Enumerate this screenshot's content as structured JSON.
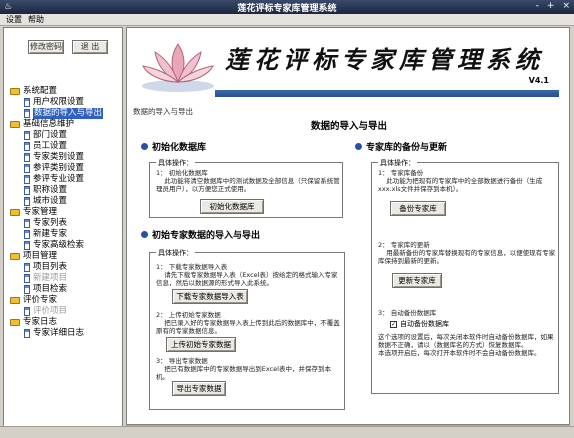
{
  "window": {
    "title": "莲花评标专家库管理系统",
    "controls": [
      "-",
      "+",
      "×"
    ]
  },
  "menu": [
    "设置",
    "帮助"
  ],
  "left": {
    "buttons": [
      "修改密码",
      "退 出"
    ],
    "tree": [
      {
        "label": "系统配置",
        "type": "folder",
        "children": [
          {
            "label": "用户权限设置"
          },
          {
            "label": "数据的导入与导出",
            "selected": true
          }
        ]
      },
      {
        "label": "基础信息维护",
        "type": "folder",
        "children": [
          {
            "label": "部门设置"
          },
          {
            "label": "员工设置"
          },
          {
            "label": "专家类别设置"
          },
          {
            "label": "参评类别设置"
          },
          {
            "label": "参评专业设置"
          },
          {
            "label": "职称设置"
          },
          {
            "label": "城市设置"
          }
        ]
      },
      {
        "label": "专家管理",
        "type": "folder",
        "children": [
          {
            "label": "专家列表"
          },
          {
            "label": "新建专家"
          },
          {
            "label": "专家高级检索"
          }
        ]
      },
      {
        "label": "项目管理",
        "type": "folder",
        "children": [
          {
            "label": "项目列表"
          },
          {
            "label": "新建项目",
            "disabled": true
          },
          {
            "label": "项目检索"
          }
        ]
      },
      {
        "label": "评价专家",
        "type": "folder",
        "children": [
          {
            "label": "评价项目",
            "disabled": true
          }
        ]
      },
      {
        "label": "专家日志",
        "type": "folder",
        "children": [
          {
            "label": "专家详细日志"
          }
        ]
      }
    ]
  },
  "banner": {
    "title": "莲花评标专家库管理系统",
    "version": "V4.1"
  },
  "breadcrumb": "数据的导入与导出",
  "page_heading": "数据的导入与导出",
  "sections": {
    "init_db": {
      "title": "初始化数据库",
      "box_title": "具体操作：",
      "desc": "1： 初始化数据库\n    此功能将清空数据库中的测试数据及全部信息（只保留系统管理员用户），以方便您正式使用。",
      "button": "初始化数据库"
    },
    "init_import": {
      "title": "初始专家数据的导入与导出",
      "box_title": "具体操作：",
      "step1": "1： 下载专家数据导入表\n    请先下载专家数据导入表（Excel表）按给定的格式输入专家信息，然后以数据源的形式导入此系统。",
      "step1_button": "下载专家数据导入表",
      "step2": "2： 上传初始专家数据\n    把已录入好的专家数据导入表上传到此后的数据库中，不覆盖原有的专家数据信息。",
      "step2_button": "上传初始专家数据",
      "step3": "3： 导出专家数据\n    把已有数据库中的专家数据导出到Excel表中，并保存到本机。",
      "step3_button": "导出专家数据"
    },
    "backup": {
      "title": "专家库的备份与更新",
      "box_title": "具体操作：",
      "step1": "1： 专家库备份\n    此功能为把现有的专家库中的全部数据进行备份（生成xxx.xls文件并保存到本机）。",
      "step1_button": "备份专家库",
      "step2": "2： 专家库的更新\n    用最新备份的专家库替换现有的专家信息，以便使现有专家库保持到最新的更新。",
      "step2_button": "更新专家库",
      "step3": "3： 自动备份数据库",
      "checkbox_label": "自动备份数据库",
      "note": "这个选项的设置后，每次关闭本软件时自动备份数据库，如果数据不正确，请以（数据库名的方式）恢复数据库。\n本选项开启后，每次打开本软件时不会自动备份数据库。"
    }
  }
}
